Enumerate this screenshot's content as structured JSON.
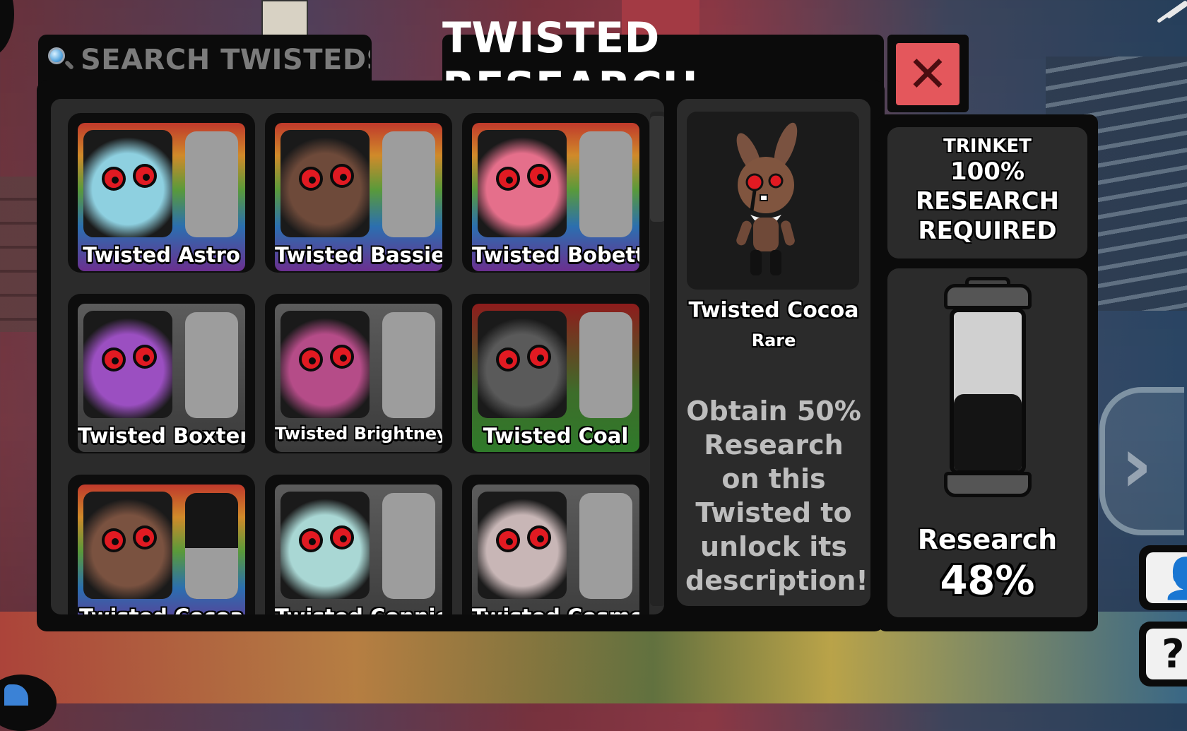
{
  "search": {
    "placeholder": "SEARCH TWISTEDS",
    "value": ""
  },
  "header": {
    "title": "TWISTED RESEARCH",
    "close_label": "✕"
  },
  "twisteds": [
    {
      "name": "Twisted Astro",
      "bg": "rainbow",
      "skin": "#8ed0e0",
      "research": 0
    },
    {
      "name": "Twisted Bassie",
      "bg": "rainbow",
      "skin": "#6e4a3a",
      "research": 0
    },
    {
      "name": "Twisted Bobette",
      "bg": "rainbow",
      "skin": "#e56f8b",
      "research": 0
    },
    {
      "name": "Twisted Boxten",
      "bg": "gray",
      "skin": "#9b4fc1",
      "research": 0
    },
    {
      "name": "Twisted Brightney",
      "bg": "gray",
      "skin": "#b54c88",
      "research": 0
    },
    {
      "name": "Twisted Coal",
      "bg": "green",
      "skin": "#5a5a5a",
      "research": 0
    },
    {
      "name": "Twisted Cocoa",
      "bg": "rainbow",
      "skin": "#7a5240",
      "research": 48
    },
    {
      "name": "Twisted Connie",
      "bg": "gray",
      "skin": "#a9d7d4",
      "research": 0
    },
    {
      "name": "Twisted Cosmo",
      "bg": "gray",
      "skin": "#c8b6b6",
      "research": 0
    }
  ],
  "detail": {
    "name": "Twisted Cocoa",
    "rarity": "Rare",
    "description": "Obtain 50% Research on this Twisted to unlock its description!"
  },
  "trinket": {
    "label": "TRINKET",
    "requirement": "100%\nRESEARCH\nREQUIRED"
  },
  "research": {
    "label": "Research",
    "percent_text": "48%",
    "fraction": 0.48
  },
  "colors": {
    "close": "#e4575c",
    "panel": "#2b2b2b",
    "frame": "#0b0b0b",
    "eye": "#e11a22"
  },
  "hud": {
    "next_icon": "chevron-right-icon",
    "profile_icon": "user-icon",
    "help_label": "?"
  }
}
